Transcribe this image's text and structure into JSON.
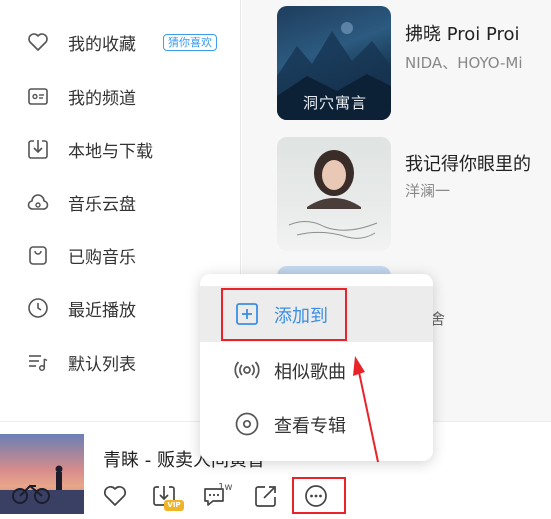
{
  "sidebar": {
    "items": [
      {
        "label": "我的收藏",
        "icon": "heart-icon",
        "badge": "猜你喜欢"
      },
      {
        "label": "我的频道",
        "icon": "channel-icon"
      },
      {
        "label": "本地与下载",
        "icon": "download-icon"
      },
      {
        "label": "音乐云盘",
        "icon": "cloud-icon"
      },
      {
        "label": "已购音乐",
        "icon": "purchased-bag-icon"
      },
      {
        "label": "最近播放",
        "icon": "clock-icon"
      },
      {
        "label": "默认列表",
        "icon": "playlist-icon"
      }
    ]
  },
  "songs": [
    {
      "title": "拂晓 Proi Proi",
      "artist": "NIDA、HOYO-Mi",
      "cover_text": "洞穴寓言"
    },
    {
      "title": "我记得你眼里的",
      "artist": "洋澜一",
      "cover_text": ""
    },
    {
      "title": "",
      "artist": "",
      "partial_text": "舍"
    }
  ],
  "context_menu": {
    "items": [
      {
        "label": "添加到",
        "icon": "plus-square-icon",
        "active": true
      },
      {
        "label": "相似歌曲",
        "icon": "radio-waves-icon"
      },
      {
        "label": "查看专辑",
        "icon": "album-disc-icon"
      }
    ]
  },
  "player": {
    "now_playing": "青睐 - 贩卖人间黄昏",
    "vip_label": "VIP",
    "comment_count": "1w",
    "controls": [
      "heart-icon",
      "download-vip-icon",
      "comment-icon",
      "share-icon",
      "more-icon"
    ]
  },
  "colors": {
    "accent": "#3a8ee6",
    "annotation": "#e8242a",
    "badge": "#3c9cf0"
  }
}
